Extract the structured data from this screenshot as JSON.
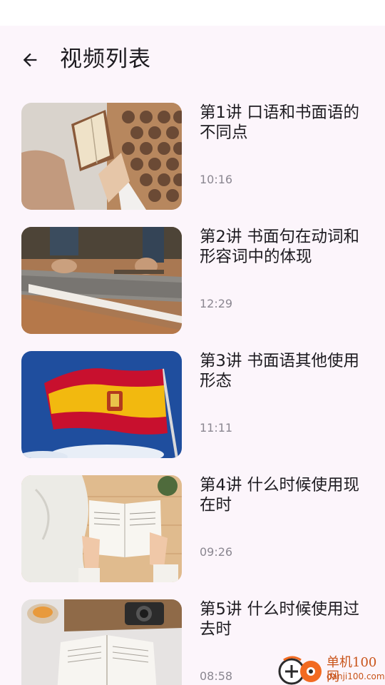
{
  "header": {
    "title": "视频列表"
  },
  "videos": [
    {
      "title": "第1讲  口语和书面语的不同点",
      "duration": "10:16"
    },
    {
      "title": "第2讲  书面句在动词和形容词中的体现",
      "duration": "12:29"
    },
    {
      "title": "第3讲  书面语其他使用形态",
      "duration": "11:11"
    },
    {
      "title": "第4讲  什么时候使用现在时",
      "duration": "09:26"
    },
    {
      "title": "第5讲  什么时候使用过去时",
      "duration": "08:58"
    }
  ],
  "watermark": {
    "name": "单机100网",
    "url": "danji100.com"
  },
  "colors": {
    "background": "#fcf5fb",
    "text": "#1d1b20",
    "secondary_text": "#8b8791",
    "watermark": "#c9541a"
  }
}
